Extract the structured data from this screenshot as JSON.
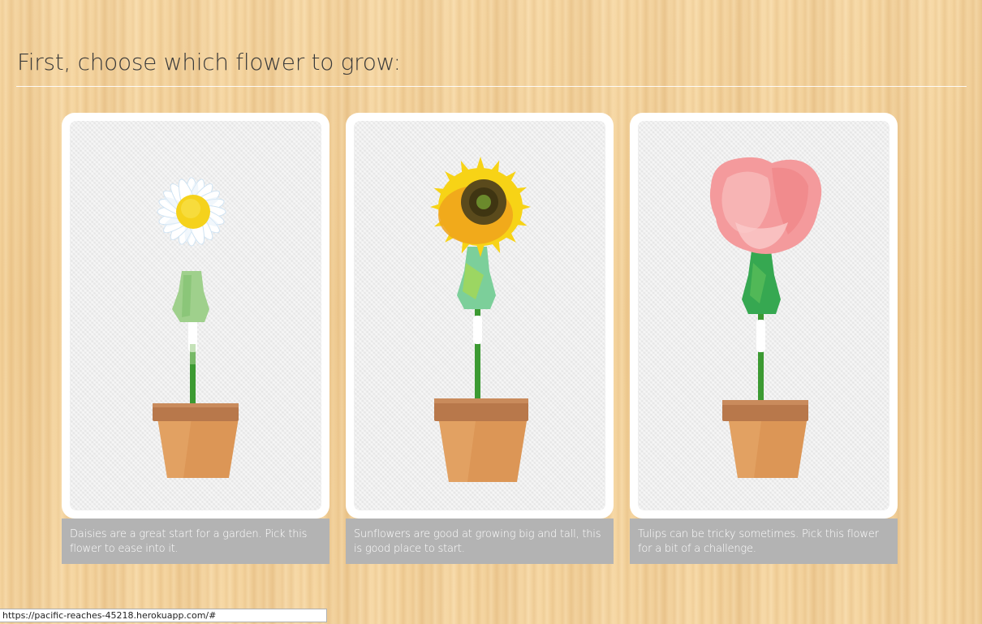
{
  "page": {
    "title": "First, choose which flower to grow:"
  },
  "flowers": [
    {
      "name": "daisy",
      "description": "Daisies are a great start for a garden. Pick this flower to ease into it.",
      "petal_color": "#ffffff",
      "center_color": "#f5d21c"
    },
    {
      "name": "sunflower",
      "description": "Sunflowers are good at growing big and tall, this is good place to start.",
      "petal_color": "#f7d316",
      "center_color": "#5a4a1c"
    },
    {
      "name": "tulip",
      "description": "Tulips can be tricky sometimes. Pick this flower for a bit of a challenge.",
      "petal_color": "#f49a9c",
      "center_color": "#f7c2c2"
    }
  ],
  "status_bar": {
    "url": "https://pacific-reaches-45218.herokuapp.com/#"
  },
  "colors": {
    "pot": "#d98f4e",
    "pot_rim": "#b5764a",
    "stem": "#3c9a32",
    "caption_bg": "#b3b3b3"
  }
}
